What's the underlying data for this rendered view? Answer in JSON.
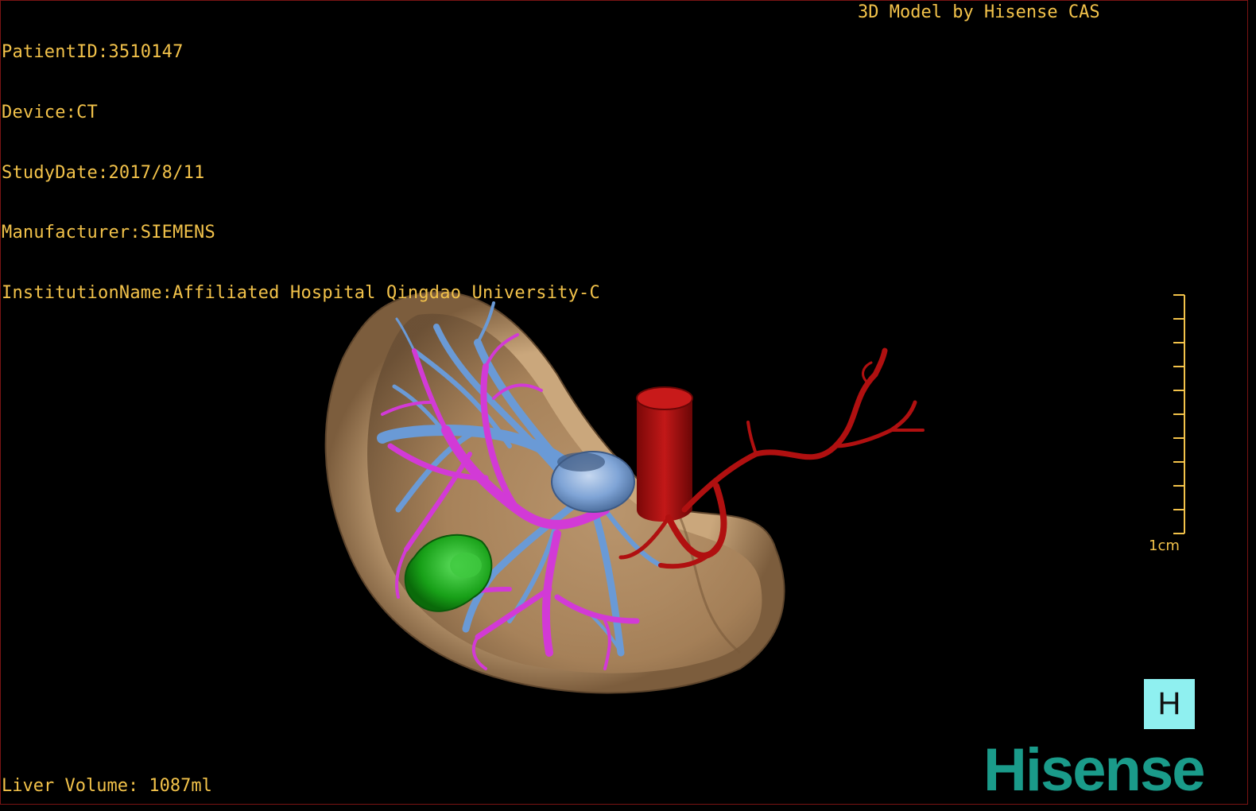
{
  "header": {
    "patient_id": "PatientID:3510147",
    "device": "Device:CT",
    "study_date": "StudyDate:2017/8/11",
    "manufacturer": "Manufacturer:SIEMENS",
    "institution": "InstitutionName:Affiliated Hospital Qingdao University-C"
  },
  "brand_caption": "3D Model by Hisense CAS",
  "footer": {
    "liver_volume": "Liver Volume: 1087ml"
  },
  "scale_bar": {
    "label": "1cm"
  },
  "orientation_cube": {
    "label": "H",
    "color": "#8ff0f0"
  },
  "logo": {
    "text": "Hisense",
    "color": "#1a9b8a"
  },
  "colors": {
    "text": "#f2c24a",
    "liver": "#c9a57b",
    "portal_vein": "#d23ad6",
    "hepatic_vein": "#6a9ad6",
    "artery": "#b01010",
    "lesion": "#20a020",
    "frame": "#7a1414"
  }
}
